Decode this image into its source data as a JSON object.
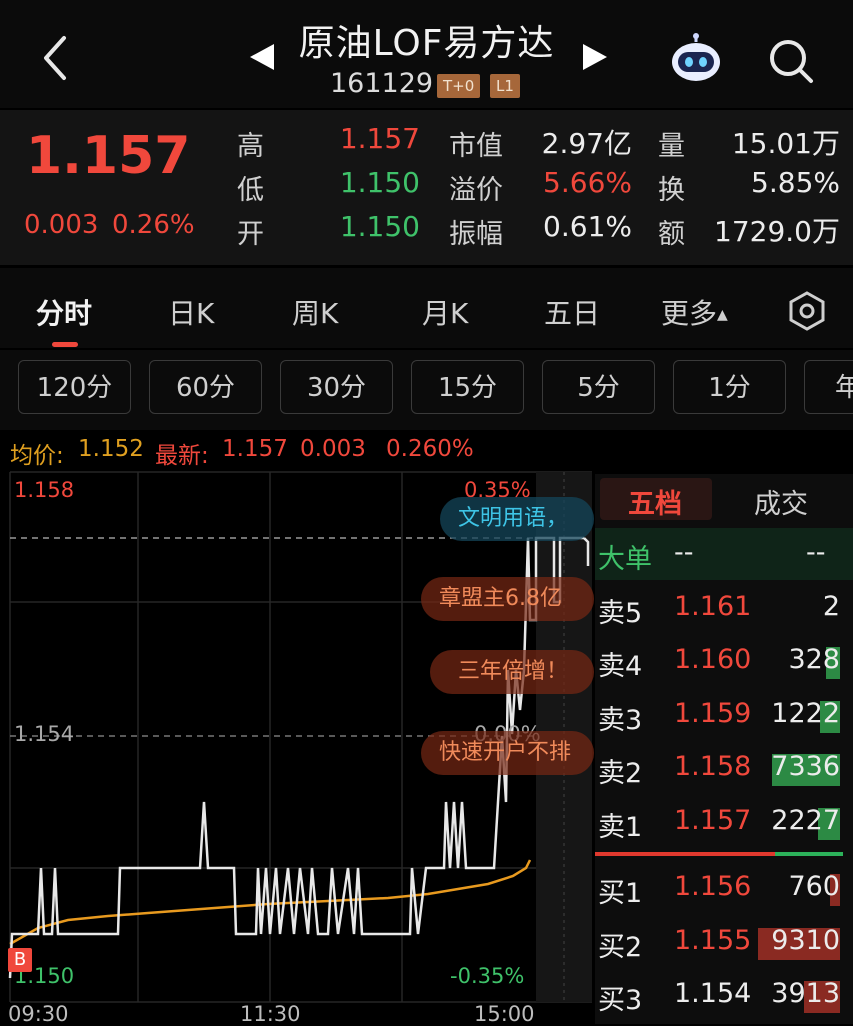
{
  "header": {
    "title": "原油LOF易方达",
    "code": "161129",
    "tags": [
      "T+0",
      "L1"
    ]
  },
  "quote": {
    "price": "1.157",
    "change": "0.003",
    "change_pct": "0.26%",
    "high_label": "高",
    "high": "1.157",
    "low_label": "低",
    "low": "1.150",
    "open_label": "开",
    "open": "1.150",
    "mcap_label": "市值",
    "mcap": "2.97亿",
    "premium_label": "溢价",
    "premium": "5.66%",
    "amplitude_label": "振幅",
    "amplitude": "0.61%",
    "volume_label": "量",
    "volume": "15.01万",
    "turnover_label": "换",
    "turnover": "5.85%",
    "amount_label": "额",
    "amount": "1729.0万"
  },
  "tabs": [
    "分时",
    "日K",
    "周K",
    "月K",
    "五日",
    "更多"
  ],
  "periods": [
    "120分",
    "60分",
    "30分",
    "15分",
    "5分",
    "1分",
    "年"
  ],
  "info": {
    "avg_label": "均价:",
    "avg": "1.152",
    "latest_label": "最新:",
    "latest": "1.157",
    "chg": "0.003",
    "chg_pct": "0.260%"
  },
  "chart": {
    "y_top": "1.158",
    "y_mid": "1.154",
    "y_bot": "1.150",
    "pct_top": "0.35%",
    "pct_mid": "0.00%",
    "pct_bot": "-0.35%",
    "x_labels": [
      "09:30",
      "11:30",
      "15:00"
    ],
    "marker": "B"
  },
  "ads": [
    "文明用语，",
    "章盟主6.8亿",
    "三年倍增！",
    "快速开户不排"
  ],
  "orderbook": {
    "tab_active": "五档",
    "tab_other": "成交",
    "big_label": "大单",
    "big_a": "--",
    "big_b": "--",
    "asks": [
      {
        "label": "卖5",
        "price": "1.161",
        "vol": "2"
      },
      {
        "label": "卖4",
        "price": "1.160",
        "vol": "328"
      },
      {
        "label": "卖3",
        "price": "1.159",
        "vol": "1222"
      },
      {
        "label": "卖2",
        "price": "1.158",
        "vol": "7336"
      },
      {
        "label": "卖1",
        "price": "1.157",
        "vol": "2227"
      }
    ],
    "bids": [
      {
        "label": "买1",
        "price": "1.156",
        "vol": "760"
      },
      {
        "label": "买2",
        "price": "1.155",
        "vol": "9310"
      },
      {
        "label": "买3",
        "price": "1.154",
        "vol": "3913"
      }
    ]
  },
  "colors": {
    "up": "#f0483c",
    "down": "#3fc26a",
    "avg_line": "#f0a020"
  }
}
